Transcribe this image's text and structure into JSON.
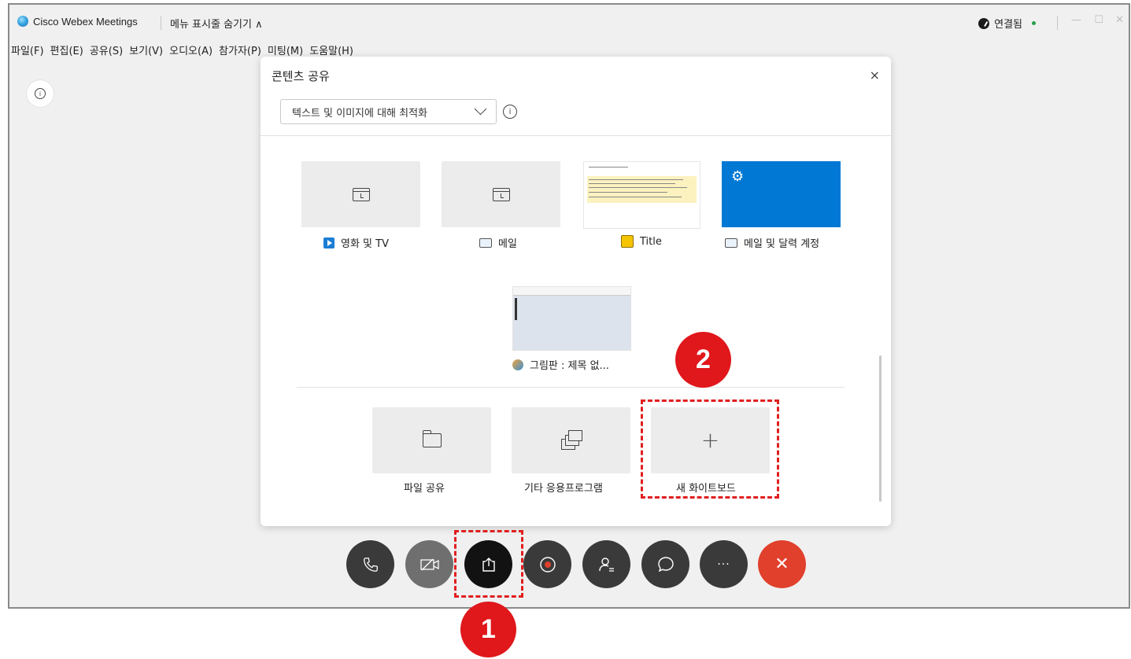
{
  "window": {
    "app_title": "Cisco Webex Meetings",
    "menu_toggle": "메뉴 표시줄 숨기기 ∧",
    "connection": "연결됨",
    "controls": {
      "minimize": "—",
      "maximize": "☐",
      "close": "✕"
    }
  },
  "menubar": [
    "파일(F)",
    "편집(E)",
    "공유(S)",
    "보기(V)",
    "오디오(A)",
    "참가자(P)",
    "미팅(M)",
    "도움말(H)"
  ],
  "panel": {
    "title": "콘텐츠 공유",
    "close": "×",
    "optimize_select": "텍스트 및 이미지에 대해 최적화",
    "info": "i",
    "apps": [
      {
        "label": "영화 및 TV",
        "icon": "movies-tv-icon"
      },
      {
        "label": "메일",
        "icon": "mail-icon"
      },
      {
        "label": "Title",
        "icon": "sticky-note-icon"
      },
      {
        "label": "메일 및 달력 계정",
        "icon": "mail-icon"
      },
      {
        "label": "그림판 : 제목 없...",
        "icon": "paint-icon"
      }
    ],
    "actions": [
      {
        "label": "파일 공유",
        "icon": "folder-icon"
      },
      {
        "label": "기타 응용프로그램",
        "icon": "windows-stack-icon"
      },
      {
        "label": "새 화이트보드",
        "icon": "plus-icon",
        "symbol": "+"
      }
    ]
  },
  "toolbar": {
    "buttons": [
      "audio",
      "video",
      "share",
      "record",
      "participants",
      "chat",
      "more",
      "leave"
    ],
    "more_label": "···",
    "leave_label": "✕"
  },
  "annotations": {
    "step1": "1",
    "step2": "2",
    "highlight_color": "#e01f1f"
  }
}
